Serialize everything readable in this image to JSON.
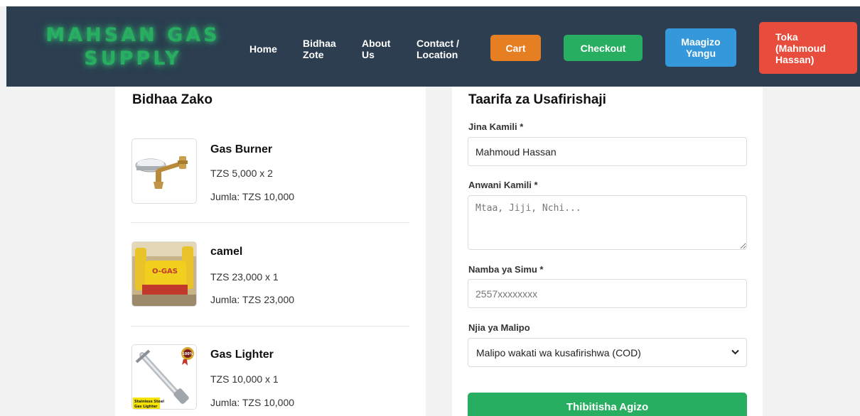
{
  "header": {
    "brand_line1": "MAHSAN GAS",
    "brand_line2": "SUPPLY",
    "nav": {
      "home": "Home",
      "bidhaa_line1": "Bidhaa",
      "bidhaa_line2": "Zote",
      "about_line1": "About",
      "about_line2": "Us",
      "contact_line1": "Contact /",
      "contact_line2": "Location"
    },
    "buttons": {
      "cart": "Cart",
      "checkout": "Checkout",
      "maagizo_line1": "Maagizo",
      "maagizo_line2": "Yangu",
      "toka_line1": "Toka",
      "toka_line2": "(Mahmoud",
      "toka_line3": "Hassan)"
    },
    "colors": {
      "nav_bg": "#2c3e50",
      "brand": "#27ae60",
      "cart": "#e67e22",
      "checkout": "#27ae60",
      "maagizo": "#3498db",
      "toka": "#e74c3c"
    }
  },
  "cart_panel": {
    "title": "Bidhaa Zako",
    "items": [
      {
        "name": "Gas Burner",
        "price_line": "TZS 5,000 x 2",
        "total_line": "Jumla: TZS 10,000",
        "image": "gas-burner-image"
      },
      {
        "name": "camel",
        "price_line": "TZS 23,000 x 1",
        "total_line": "Jumla: TZS 23,000",
        "image": "camel-gas-cylinder-image"
      },
      {
        "name": "Gas Lighter",
        "price_line": "TZS 10,000 x 1",
        "total_line": "Jumla: TZS 10,000",
        "image": "gas-lighter-image",
        "image_caption_1": "Stainless Steel",
        "image_caption_2": "Gas Lighter",
        "badge": "100%"
      }
    ],
    "camel_image_text": "O-GAS"
  },
  "shipping_form": {
    "title": "Taarifa za Usafirishaji",
    "full_name_label": "Jina Kamili *",
    "full_name_value": "Mahmoud Hassan",
    "address_label": "Anwani Kamili *",
    "address_placeholder": "Mtaa, Jiji, Nchi...",
    "phone_label": "Namba ya Simu *",
    "phone_placeholder": "2557xxxxxxxx",
    "payment_label": "Njia ya Malipo",
    "payment_selected": "Malipo wakati wa kusafirishwa (COD)",
    "submit_label": "Thibitisha Agizo",
    "submit_color": "#27ae60"
  }
}
